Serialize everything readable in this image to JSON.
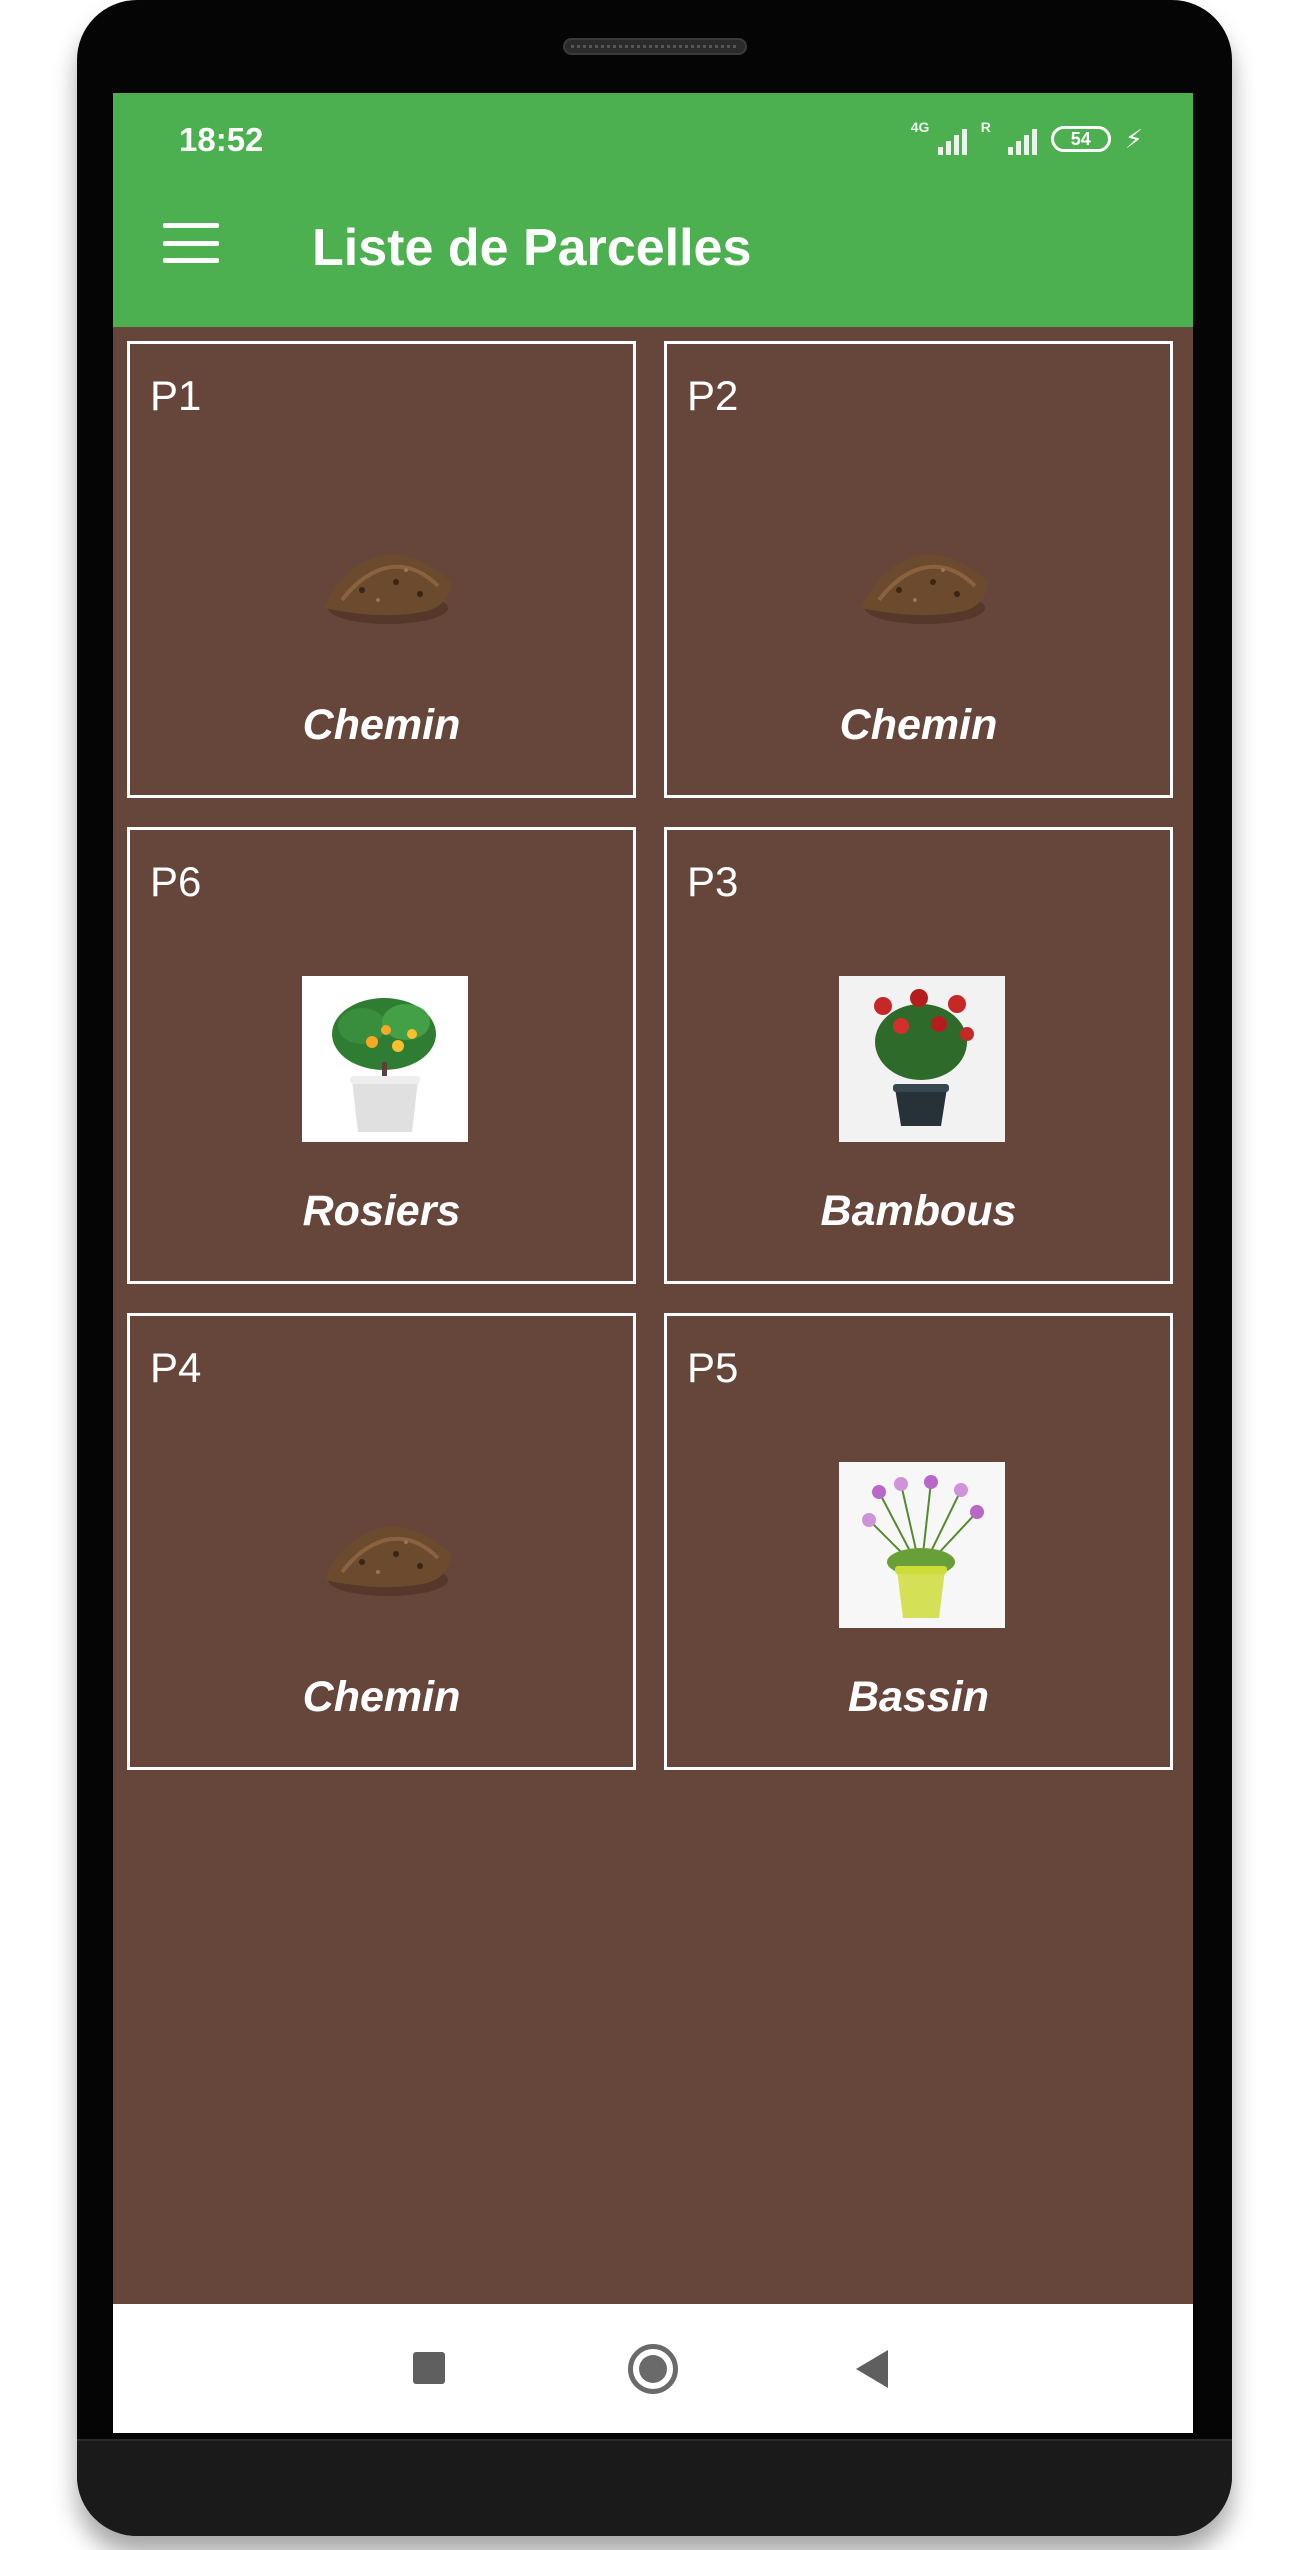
{
  "status_bar": {
    "time": "18:52",
    "network_1": "4G",
    "network_2": "R",
    "battery": "54"
  },
  "app_bar": {
    "title": "Liste de Parcelles",
    "menu_icon": "hamburger-menu-icon"
  },
  "parcels": [
    {
      "id": "P1",
      "name": "Chemin",
      "image": "soil-pile-image"
    },
    {
      "id": "P2",
      "name": "Chemin",
      "image": "soil-pile-image"
    },
    {
      "id": "P6",
      "name": "Rosiers",
      "image": "potted-citrus-tree-image"
    },
    {
      "id": "P3",
      "name": "Bambous",
      "image": "potted-red-roses-image"
    },
    {
      "id": "P4",
      "name": "Chemin",
      "image": "soil-pile-image"
    },
    {
      "id": "P5",
      "name": "Bassin",
      "image": "potted-purple-flowers-image"
    }
  ],
  "nav_bar": {
    "recents_icon": "square-recents-icon",
    "home_icon": "circle-home-icon",
    "back_icon": "triangle-back-icon"
  },
  "colors": {
    "app_bar": "#4caf50",
    "background": "#66453a",
    "card_border": "#ffffff"
  }
}
